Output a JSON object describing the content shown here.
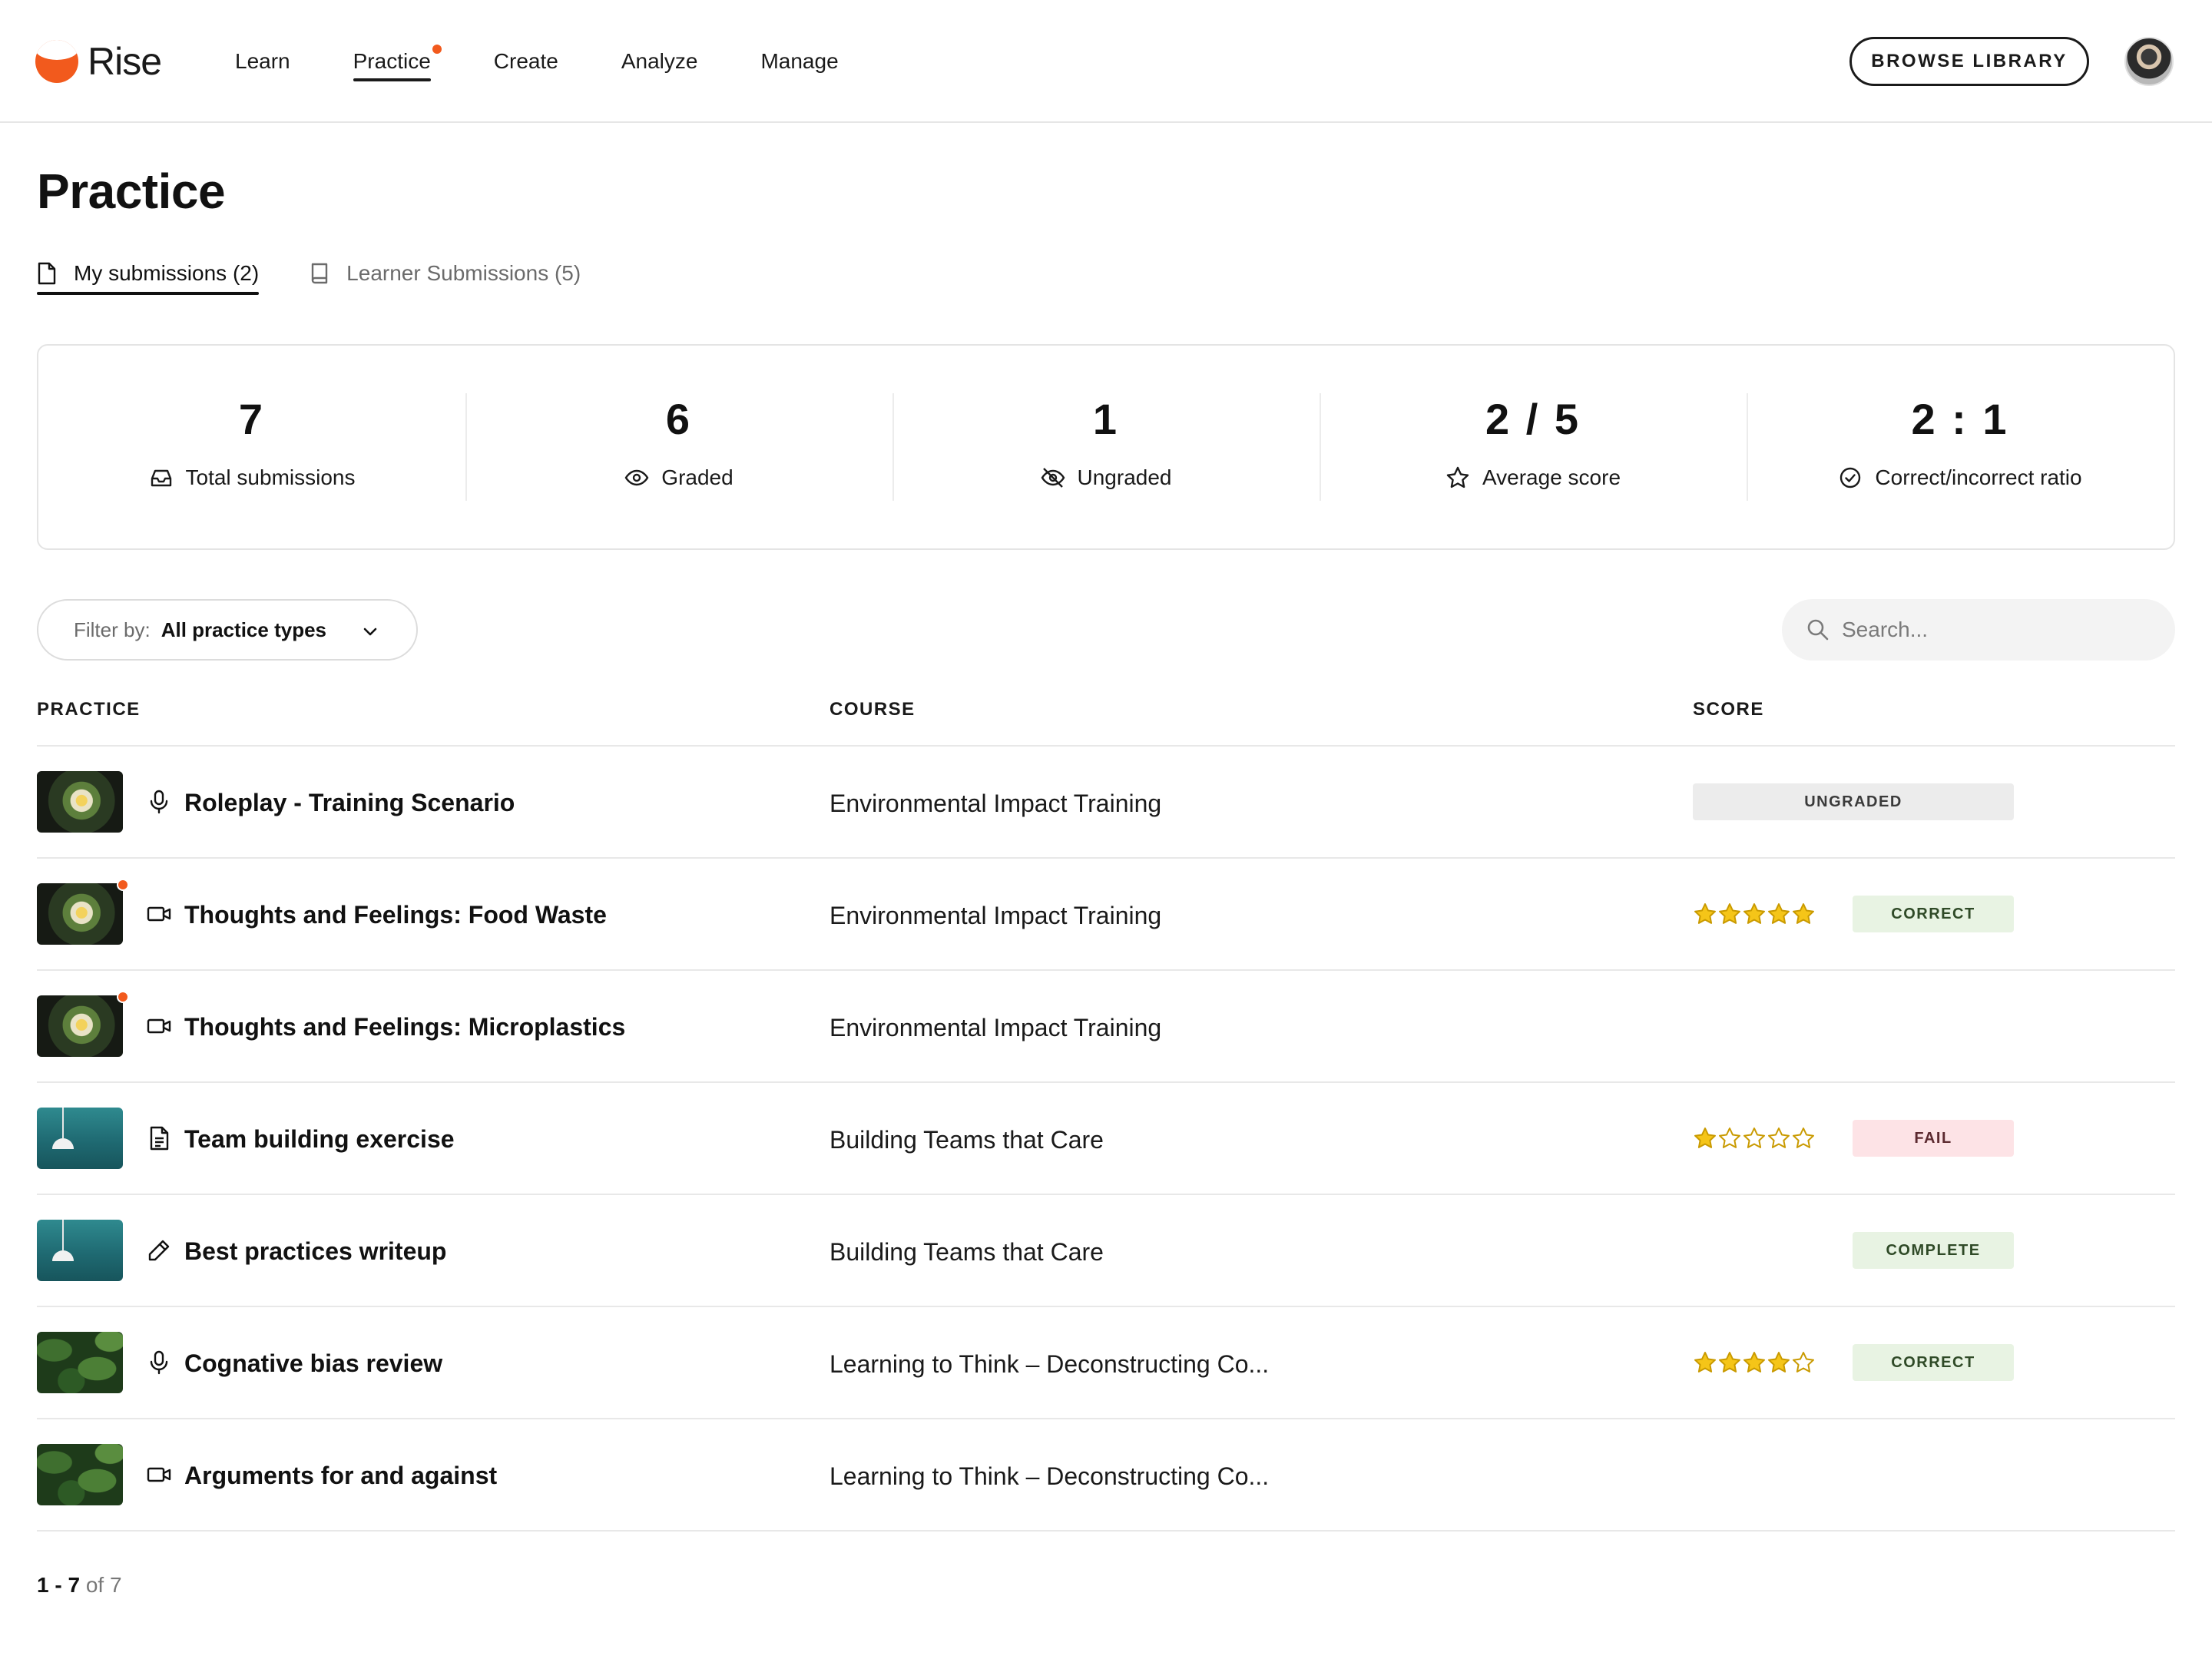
{
  "header": {
    "logo_text": "Rise",
    "nav": [
      "Learn",
      "Practice",
      "Create",
      "Analyze",
      "Manage"
    ],
    "active_nav": "Practice",
    "browse_label": "BROWSE LIBRARY",
    "accent_color": "#f25a1d"
  },
  "page": {
    "title": "Practice",
    "tabs": [
      {
        "label": "My submissions (2)",
        "icon": "file-icon",
        "active": true
      },
      {
        "label": "Learner Submissions (5)",
        "icon": "book-icon",
        "active": false
      }
    ]
  },
  "stats": [
    {
      "value": "7",
      "label": "Total submissions",
      "icon": "inbox-icon"
    },
    {
      "value": "6",
      "label": "Graded",
      "icon": "eye-icon"
    },
    {
      "value": "1",
      "label": "Ungraded",
      "icon": "eye-off-icon"
    },
    {
      "value": "2 / 5",
      "label": "Average score",
      "icon": "star-icon"
    },
    {
      "value": "2 : 1",
      "label": "Correct/incorrect ratio",
      "icon": "check-circle-icon"
    }
  ],
  "filter": {
    "label": "Filter by:",
    "value": "All practice types"
  },
  "search": {
    "placeholder": "Search..."
  },
  "table": {
    "columns": [
      "PRACTICE",
      "COURSE",
      "SCORE"
    ],
    "rows": [
      {
        "name": "Roleplay - Training Scenario",
        "course": "Environmental Impact Training",
        "type_icon": "microphone-icon",
        "thumb": "food",
        "unread": false,
        "stars": null,
        "badge": "UNGRADED",
        "badge_kind": "ungraded"
      },
      {
        "name": "Thoughts and Feelings: Food Waste",
        "course": "Environmental Impact Training",
        "type_icon": "video-icon",
        "thumb": "food",
        "unread": true,
        "stars": 5,
        "badge": "CORRECT",
        "badge_kind": "correct"
      },
      {
        "name": "Thoughts and Feelings: Microplastics",
        "course": "Environmental Impact Training",
        "type_icon": "video-icon",
        "thumb": "food",
        "unread": true,
        "stars": null,
        "badge": null,
        "badge_kind": null
      },
      {
        "name": "Team building exercise",
        "course": "Building Teams that Care",
        "type_icon": "document-icon",
        "thumb": "lamp",
        "unread": false,
        "stars": 1,
        "badge": "FAIL",
        "badge_kind": "fail"
      },
      {
        "name": "Best practices writeup",
        "course": "Building Teams that Care",
        "type_icon": "pencil-icon",
        "thumb": "lamp",
        "unread": false,
        "stars": null,
        "badge": "COMPLETE",
        "badge_kind": "complete"
      },
      {
        "name": "Cognative bias review",
        "course": "Learning to Think – Deconstructing Co...",
        "type_icon": "microphone-icon",
        "thumb": "leaves",
        "unread": false,
        "stars": 4,
        "badge": "CORRECT",
        "badge_kind": "correct"
      },
      {
        "name": "Arguments for and against",
        "course": "Learning to Think – Deconstructing Co...",
        "type_icon": "video-icon",
        "thumb": "leaves",
        "unread": false,
        "stars": null,
        "badge": null,
        "badge_kind": null
      }
    ]
  },
  "pagination": {
    "range": "1 - 7",
    "total_text": "of 7"
  }
}
